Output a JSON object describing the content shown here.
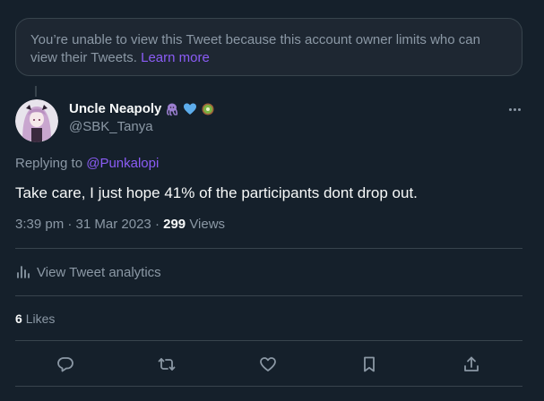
{
  "notice": {
    "text": "You’re unable to view this Tweet because this account owner limits who can view their Tweets.",
    "link": "Learn more"
  },
  "tweet": {
    "display_name": "Uncle Neapoly",
    "emojis": [
      "octopus-emoji",
      "blue-heart-emoji",
      "kiwi-emoji"
    ],
    "handle": "@SBK_Tanya",
    "replying_prefix": "Replying to",
    "replying_to": "@Punkalopi",
    "text": "Take care, I just hope 41% of the participants dont drop out.",
    "time": "3:39 pm · 31 Mar 2023",
    "separator": "·",
    "views_count": "299",
    "views_label": "Views"
  },
  "analytics": {
    "label": "View Tweet analytics",
    "icon": "bar-chart-icon"
  },
  "engagement": {
    "likes_count": "6",
    "likes_label": "Likes"
  },
  "actions": [
    "reply-icon",
    "retweet-icon",
    "like-icon",
    "bookmark-icon",
    "share-icon"
  ],
  "colors": {
    "background": "#15202b",
    "accent": "#8b5cf6",
    "muted": "#8b98a5",
    "text": "#f7f9f9",
    "border": "#38444d"
  }
}
